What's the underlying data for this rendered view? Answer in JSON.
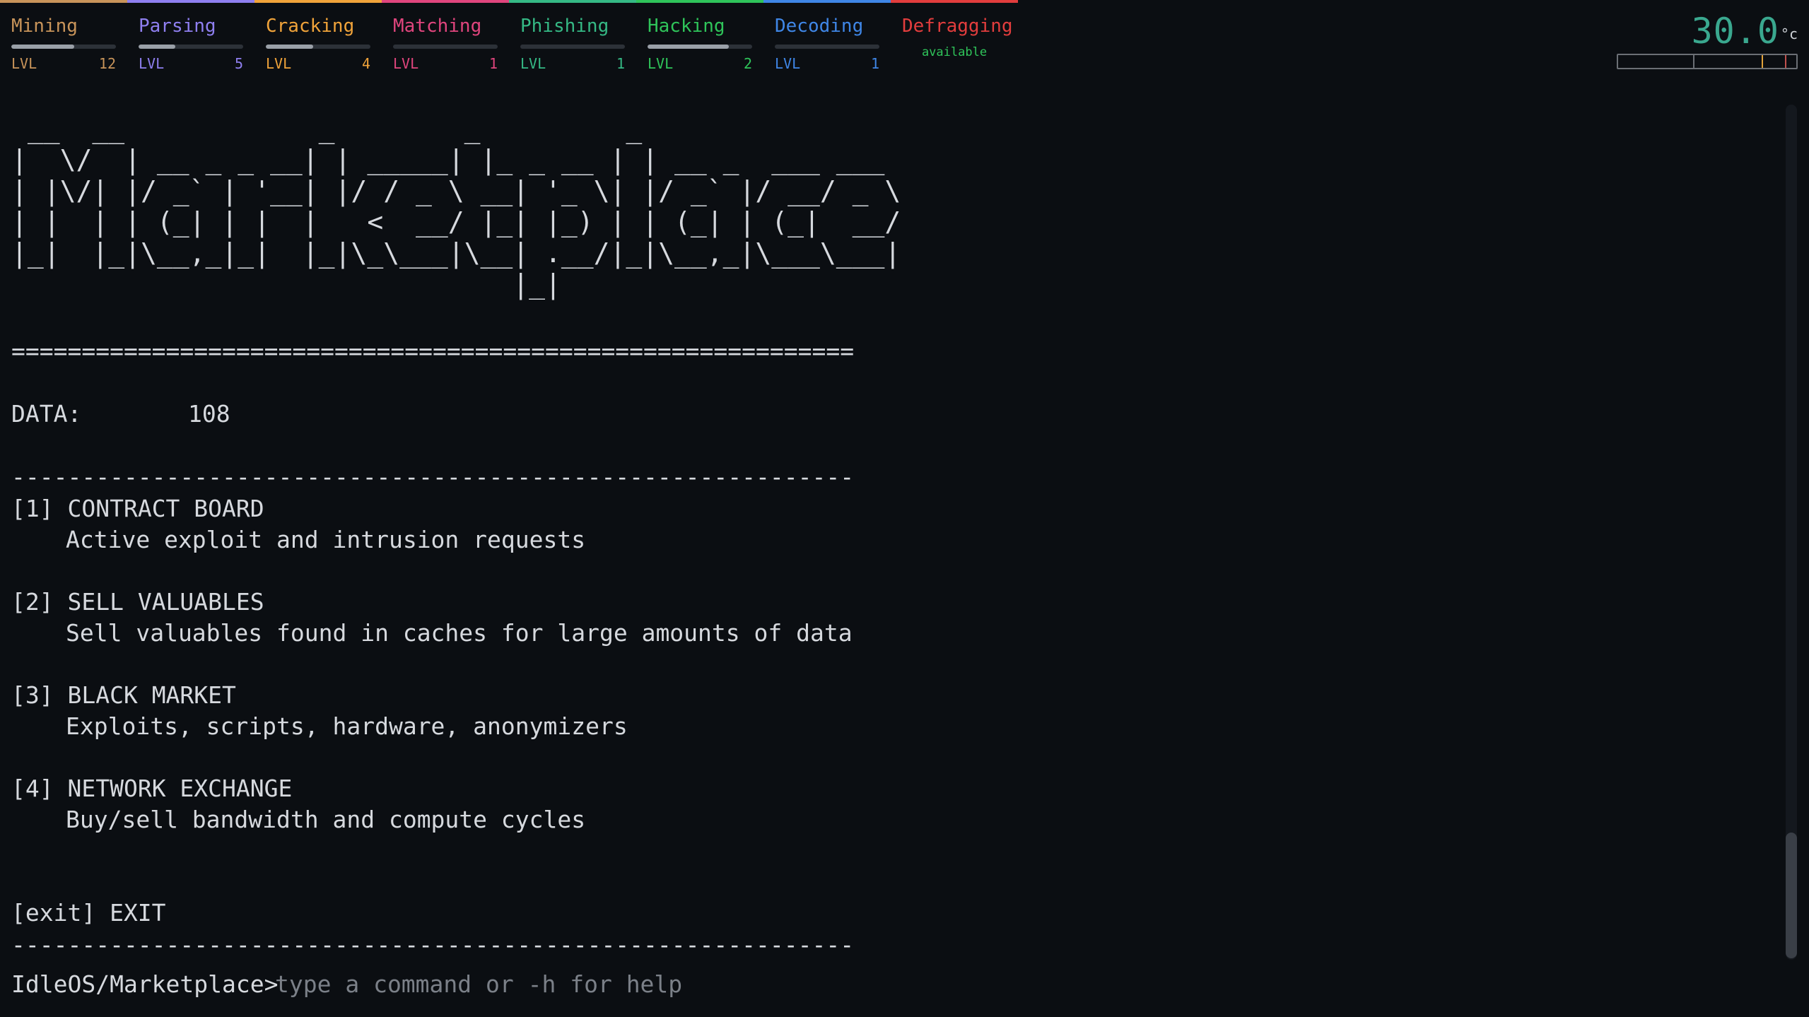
{
  "skills": [
    {
      "name": "Mining",
      "color": "#c8945a",
      "level": "12",
      "progress": 0.6,
      "lvl_label": "LVL"
    },
    {
      "name": "Parsing",
      "color": "#8f7ff0",
      "level": "5",
      "progress": 0.35,
      "lvl_label": "LVL"
    },
    {
      "name": "Cracking",
      "color": "#f0a33a",
      "level": "4",
      "progress": 0.45,
      "lvl_label": "LVL"
    },
    {
      "name": "Matching",
      "color": "#e0457d",
      "level": "1",
      "progress": 0.0,
      "lvl_label": "LVL"
    },
    {
      "name": "Phishing",
      "color": "#35b985",
      "level": "1",
      "progress": 0.0,
      "lvl_label": "LVL"
    },
    {
      "name": "Hacking",
      "color": "#2fc45a",
      "level": "2",
      "progress": 0.78,
      "lvl_label": "LVL"
    },
    {
      "name": "Decoding",
      "color": "#3f86e6",
      "level": "1",
      "progress": 0.0,
      "lvl_label": "LVL"
    },
    {
      "name": "Defragging",
      "color": "#e23d3d",
      "status": "available",
      "status_color": "#2fc45a"
    }
  ],
  "temperature": {
    "value": "30.0",
    "unit": "°c",
    "value_color": "#3aa88f",
    "marker_color": "#e2a33a"
  },
  "terminal": {
    "banner": " __  __            _        _         _\n|  \\/  | __ _ _ __| | _____| |_ _ __ | | __ _  ___ ___\n| |\\/| |/ _` | '__| |/ / _ \\ __| '_ \\| |/ _` |/ __/ _ \\\n| |  | | (_| | |  |   <  __/ |_| |_) | | (_| | (_|  __/\n|_|  |_|\\__,_|_|  |_|\\_\\___|\\__| .__/|_|\\__,_|\\___\\___|\n                               |_|",
    "separator_double": "============================================================",
    "data_label": "DATA:",
    "data_value": "108",
    "separator_single": "------------------------------------------------------------",
    "menu": [
      {
        "key": "[1]",
        "title": "CONTRACT BOARD",
        "desc": "Active exploit and intrusion requests"
      },
      {
        "key": "[2]",
        "title": "SELL VALUABLES",
        "desc": "Sell valuables found in caches for large amounts of data"
      },
      {
        "key": "[3]",
        "title": "BLACK MARKET",
        "desc": "Exploits, scripts, hardware, anonymizers"
      },
      {
        "key": "[4]",
        "title": "NETWORK EXCHANGE",
        "desc": "Buy/sell bandwidth and compute cycles"
      }
    ],
    "exit_label": "[exit] EXIT",
    "prompt": "IdleOS/Marketplace>",
    "input_placeholder": "type a command or -h for help",
    "input_value": ""
  }
}
